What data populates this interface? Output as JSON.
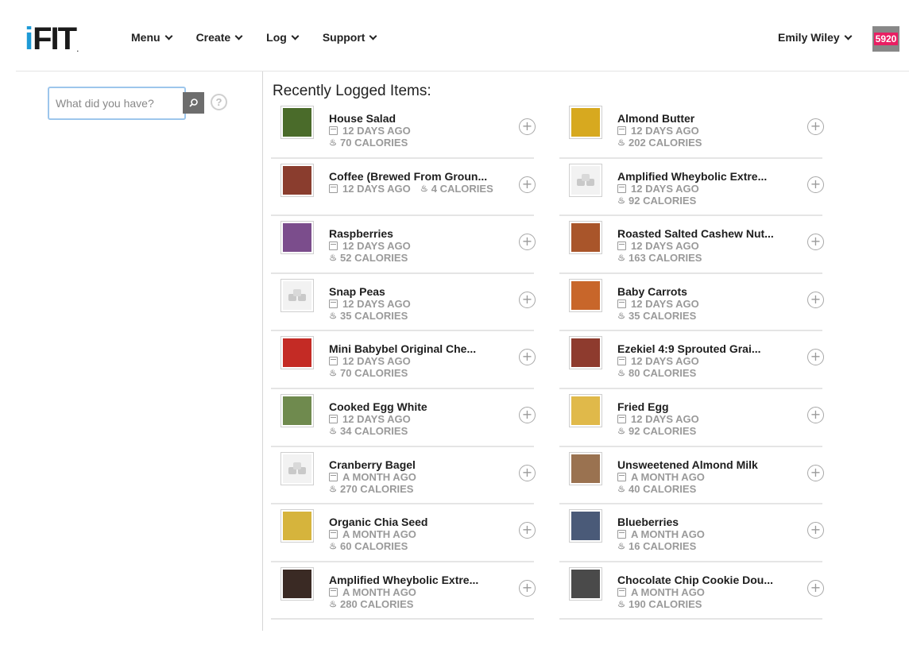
{
  "header": {
    "logo": {
      "i": "i",
      "fit": "FIT",
      "dot": "."
    },
    "nav": [
      {
        "label": "Menu"
      },
      {
        "label": "Create"
      },
      {
        "label": "Log"
      },
      {
        "label": "Support"
      }
    ],
    "user_name": "Emily Wiley",
    "avatar_badge": "5920"
  },
  "sidebar": {
    "search_placeholder": "What did you have?",
    "search_icon": "search-icon",
    "help_symbol": "?"
  },
  "main": {
    "title": "Recently Logged Items:",
    "items": [
      {
        "name": "House Salad",
        "when": "12 DAYS AGO",
        "calories": "70 CALORIES",
        "thumb_color": "#4a6b2a",
        "placeholder": false
      },
      {
        "name": "Almond Butter",
        "when": "12 DAYS AGO",
        "calories": "202 CALORIES",
        "thumb_color": "#d7a91f",
        "placeholder": false
      },
      {
        "name": "Coffee (Brewed From Groun...",
        "when": "12 DAYS AGO",
        "calories": "4 CALORIES",
        "inline": true,
        "thumb_color": "#8a3d2e",
        "placeholder": false
      },
      {
        "name": "Amplified Wheybolic Extre...",
        "when": "12 DAYS AGO",
        "calories": "92 CALORIES",
        "thumb_color": "#d8d8d8",
        "placeholder": true
      },
      {
        "name": "Raspberries",
        "when": "12 DAYS AGO",
        "calories": "52 CALORIES",
        "thumb_color": "#7b4d8c",
        "placeholder": false
      },
      {
        "name": "Roasted Salted Cashew Nut...",
        "when": "12 DAYS AGO",
        "calories": "163 CALORIES",
        "thumb_color": "#a9552a",
        "placeholder": false
      },
      {
        "name": "Snap Peas",
        "when": "12 DAYS AGO",
        "calories": "35 CALORIES",
        "thumb_color": "#d8d8d8",
        "placeholder": true
      },
      {
        "name": "Baby Carrots",
        "when": "12 DAYS AGO",
        "calories": "35 CALORIES",
        "thumb_color": "#c8662a",
        "placeholder": false
      },
      {
        "name": "Mini Babybel Original Che...",
        "when": "12 DAYS AGO",
        "calories": "70 CALORIES",
        "thumb_color": "#c42b25",
        "placeholder": false
      },
      {
        "name": "Ezekiel 4:9 Sprouted Grai...",
        "when": "12 DAYS AGO",
        "calories": "80 CALORIES",
        "thumb_color": "#8e3b2e",
        "placeholder": false
      },
      {
        "name": "Cooked Egg White",
        "when": "12 DAYS AGO",
        "calories": "34 CALORIES",
        "thumb_color": "#6f8a4e",
        "placeholder": false
      },
      {
        "name": "Fried Egg",
        "when": "12 DAYS AGO",
        "calories": "92 CALORIES",
        "thumb_color": "#e0b94a",
        "placeholder": false
      },
      {
        "name": "Cranberry Bagel",
        "when": "A MONTH AGO",
        "calories": "270 CALORIES",
        "thumb_color": "#d8d8d8",
        "placeholder": true
      },
      {
        "name": "Unsweetened Almond Milk",
        "when": "A MONTH AGO",
        "calories": "40 CALORIES",
        "thumb_color": "#9a7250",
        "placeholder": false
      },
      {
        "name": "Organic Chia Seed",
        "when": "A MONTH AGO",
        "calories": "60 CALORIES",
        "thumb_color": "#d6b43c",
        "placeholder": false
      },
      {
        "name": "Blueberries",
        "when": "A MONTH AGO",
        "calories": "16 CALORIES",
        "thumb_color": "#4a5a78",
        "placeholder": false
      },
      {
        "name": "Amplified Wheybolic Extre...",
        "when": "A MONTH AGO",
        "calories": "280 CALORIES",
        "thumb_color": "#3a2a24",
        "placeholder": false
      },
      {
        "name": "Chocolate Chip Cookie Dou...",
        "when": "A MONTH AGO",
        "calories": "190 CALORIES",
        "thumb_color": "#4a4a4a",
        "placeholder": false
      }
    ]
  },
  "colors": {
    "brand_blue": "#1e9ad6",
    "muted_text": "#9a9a9a",
    "badge_pink": "#e91e63"
  }
}
